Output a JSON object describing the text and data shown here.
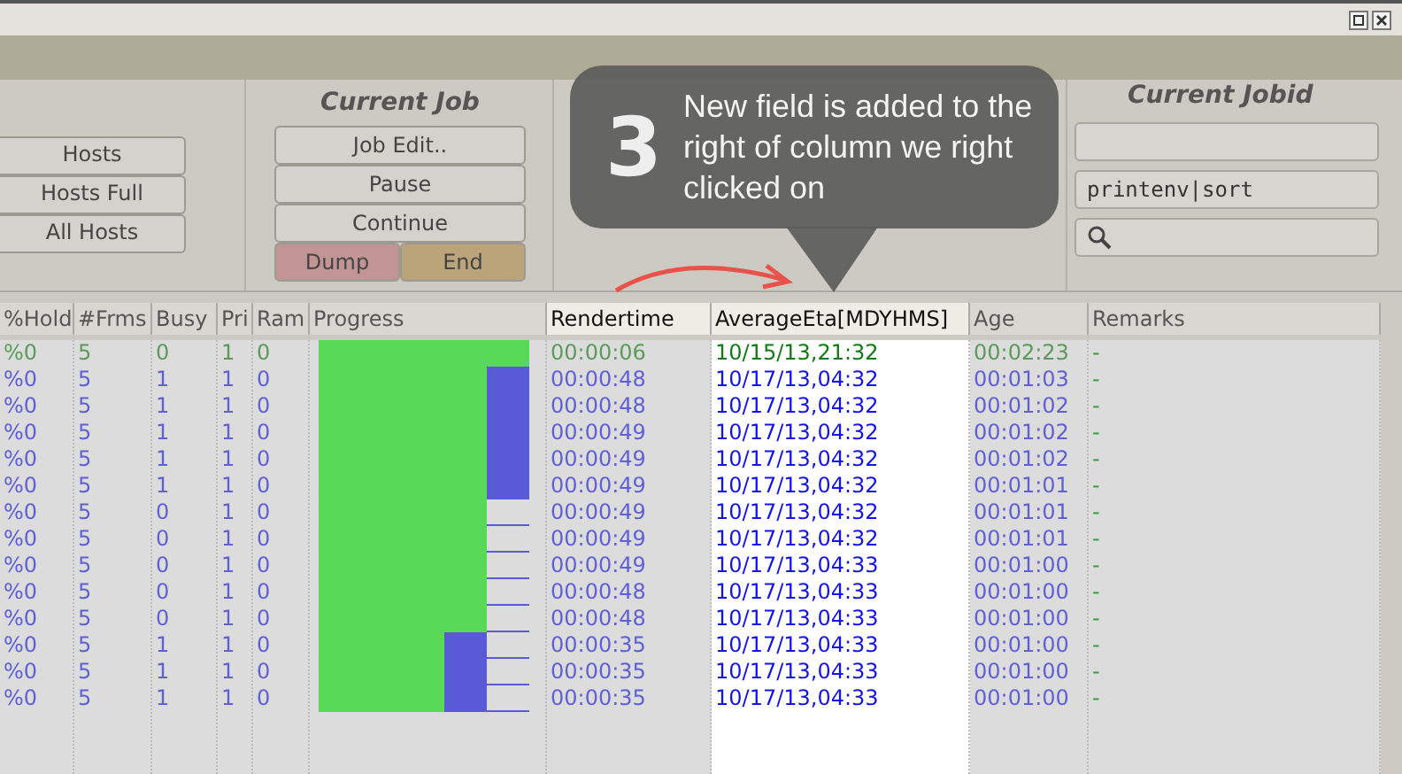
{
  "window": {
    "buttons": [
      {
        "kind": "restore"
      },
      {
        "kind": "close"
      }
    ]
  },
  "hosts_panel": {
    "buttons": [
      "Hosts",
      "Hosts Full",
      "All Hosts"
    ]
  },
  "current_job": {
    "title": "Current Job",
    "buttons": [
      "Job Edit..",
      "Pause",
      "Continue"
    ],
    "pair": [
      {
        "label": "Dump",
        "kind": "danger"
      },
      {
        "label": "End",
        "kind": "warn"
      }
    ]
  },
  "current_jobid": {
    "title": "Current Jobid",
    "fields": [
      {
        "kind": "text"
      },
      {
        "kind": "text",
        "value": "printenv|sort"
      },
      {
        "kind": "search"
      }
    ]
  },
  "table": {
    "columns": [
      "%Hold",
      "#Frms",
      "Busy",
      "Pri",
      "Ram",
      "Progress",
      "Rendertime",
      "AverageEta[MDYHMS]",
      "Age",
      "Remarks"
    ],
    "rows": [
      {
        "finished": true,
        "hold": "%0",
        "frames": "5",
        "busy": "0",
        "pri": "1",
        "ram": "0",
        "progress": [
          {
            "done": true
          },
          {
            "done": true
          },
          {
            "done": true
          },
          {
            "done": true
          },
          {
            "done": true
          }
        ],
        "rendertime": "00:00:06",
        "eta": "10/15/13,21:32",
        "age": "00:02:23",
        "remarks": "-"
      },
      {
        "finished": false,
        "hold": "%0",
        "frames": "5",
        "busy": "1",
        "pri": "1",
        "ram": "0",
        "progress": [
          {
            "done": true
          },
          {
            "done": true
          },
          {
            "done": true
          },
          {
            "done": true
          },
          {
            "busy": true
          }
        ],
        "rendertime": "00:00:48",
        "eta": "10/17/13,04:32",
        "age": "00:01:03",
        "remarks": "-"
      },
      {
        "finished": false,
        "hold": "%0",
        "frames": "5",
        "busy": "1",
        "pri": "1",
        "ram": "0",
        "progress": [
          {
            "done": true
          },
          {
            "done": true
          },
          {
            "done": true
          },
          {
            "done": true
          },
          {
            "busy": true
          }
        ],
        "rendertime": "00:00:48",
        "eta": "10/17/13,04:32",
        "age": "00:01:02",
        "remarks": "-"
      },
      {
        "finished": false,
        "hold": "%0",
        "frames": "5",
        "busy": "1",
        "pri": "1",
        "ram": "0",
        "progress": [
          {
            "done": true
          },
          {
            "done": true
          },
          {
            "done": true
          },
          {
            "done": true
          },
          {
            "busy": true
          }
        ],
        "rendertime": "00:00:49",
        "eta": "10/17/13,04:32",
        "age": "00:01:02",
        "remarks": "-"
      },
      {
        "finished": false,
        "hold": "%0",
        "frames": "5",
        "busy": "1",
        "pri": "1",
        "ram": "0",
        "progress": [
          {
            "done": true
          },
          {
            "done": true
          },
          {
            "done": true
          },
          {
            "done": true
          },
          {
            "busy": true
          }
        ],
        "rendertime": "00:00:49",
        "eta": "10/17/13,04:32",
        "age": "00:01:02",
        "remarks": "-"
      },
      {
        "finished": false,
        "hold": "%0",
        "frames": "5",
        "busy": "1",
        "pri": "1",
        "ram": "0",
        "progress": [
          {
            "done": true
          },
          {
            "done": true
          },
          {
            "done": true
          },
          {
            "done": true
          },
          {
            "busy": true
          }
        ],
        "rendertime": "00:00:49",
        "eta": "10/17/13,04:32",
        "age": "00:01:01",
        "remarks": "-"
      },
      {
        "finished": false,
        "hold": "%0",
        "frames": "5",
        "busy": "0",
        "pri": "1",
        "ram": "0",
        "progress": [
          {
            "done": true
          },
          {
            "done": true
          },
          {
            "done": true
          },
          {
            "done": true
          },
          {
            "done": false,
            "busy": false
          }
        ],
        "rendertime": "00:00:49",
        "eta": "10/17/13,04:32",
        "age": "00:01:01",
        "remarks": "-"
      },
      {
        "finished": false,
        "hold": "%0",
        "frames": "5",
        "busy": "0",
        "pri": "1",
        "ram": "0",
        "progress": [
          {
            "done": true
          },
          {
            "done": true
          },
          {
            "done": true
          },
          {
            "done": true
          },
          {
            "done": false,
            "busy": false
          }
        ],
        "rendertime": "00:00:49",
        "eta": "10/17/13,04:32",
        "age": "00:01:01",
        "remarks": "-"
      },
      {
        "finished": false,
        "hold": "%0",
        "frames": "5",
        "busy": "0",
        "pri": "1",
        "ram": "0",
        "progress": [
          {
            "done": true
          },
          {
            "done": true
          },
          {
            "done": true
          },
          {
            "done": true
          },
          {
            "done": false,
            "busy": false
          }
        ],
        "rendertime": "00:00:49",
        "eta": "10/17/13,04:33",
        "age": "00:01:00",
        "remarks": "-"
      },
      {
        "finished": false,
        "hold": "%0",
        "frames": "5",
        "busy": "0",
        "pri": "1",
        "ram": "0",
        "progress": [
          {
            "done": true
          },
          {
            "done": true
          },
          {
            "done": true
          },
          {
            "done": true
          },
          {
            "done": false,
            "busy": false
          }
        ],
        "rendertime": "00:00:48",
        "eta": "10/17/13,04:33",
        "age": "00:01:00",
        "remarks": "-"
      },
      {
        "finished": false,
        "hold": "%0",
        "frames": "5",
        "busy": "0",
        "pri": "1",
        "ram": "0",
        "progress": [
          {
            "done": true
          },
          {
            "done": true
          },
          {
            "done": true
          },
          {
            "done": true
          },
          {
            "done": false,
            "busy": false
          }
        ],
        "rendertime": "00:00:48",
        "eta": "10/17/13,04:33",
        "age": "00:01:00",
        "remarks": "-"
      },
      {
        "finished": false,
        "hold": "%0",
        "frames": "5",
        "busy": "1",
        "pri": "1",
        "ram": "0",
        "progress": [
          {
            "done": true
          },
          {
            "done": true
          },
          {
            "done": true
          },
          {
            "busy": true
          },
          {
            "done": false,
            "busy": false
          }
        ],
        "rendertime": "00:00:35",
        "eta": "10/17/13,04:33",
        "age": "00:01:00",
        "remarks": "-"
      },
      {
        "finished": false,
        "hold": "%0",
        "frames": "5",
        "busy": "1",
        "pri": "1",
        "ram": "0",
        "progress": [
          {
            "done": true
          },
          {
            "done": true
          },
          {
            "done": true
          },
          {
            "busy": true
          },
          {
            "done": false,
            "busy": false
          }
        ],
        "rendertime": "00:00:35",
        "eta": "10/17/13,04:33",
        "age": "00:01:00",
        "remarks": "-"
      },
      {
        "finished": false,
        "hold": "%0",
        "frames": "5",
        "busy": "1",
        "pri": "1",
        "ram": "0",
        "progress": [
          {
            "done": true
          },
          {
            "done": true
          },
          {
            "done": true
          },
          {
            "busy": true
          },
          {
            "done": false,
            "busy": false
          }
        ],
        "rendertime": "00:00:35",
        "eta": "10/17/13,04:33",
        "age": "00:01:00",
        "remarks": "-"
      }
    ]
  },
  "callout": {
    "number": "3",
    "text": "New field is added to the right of column we right clicked on"
  }
}
